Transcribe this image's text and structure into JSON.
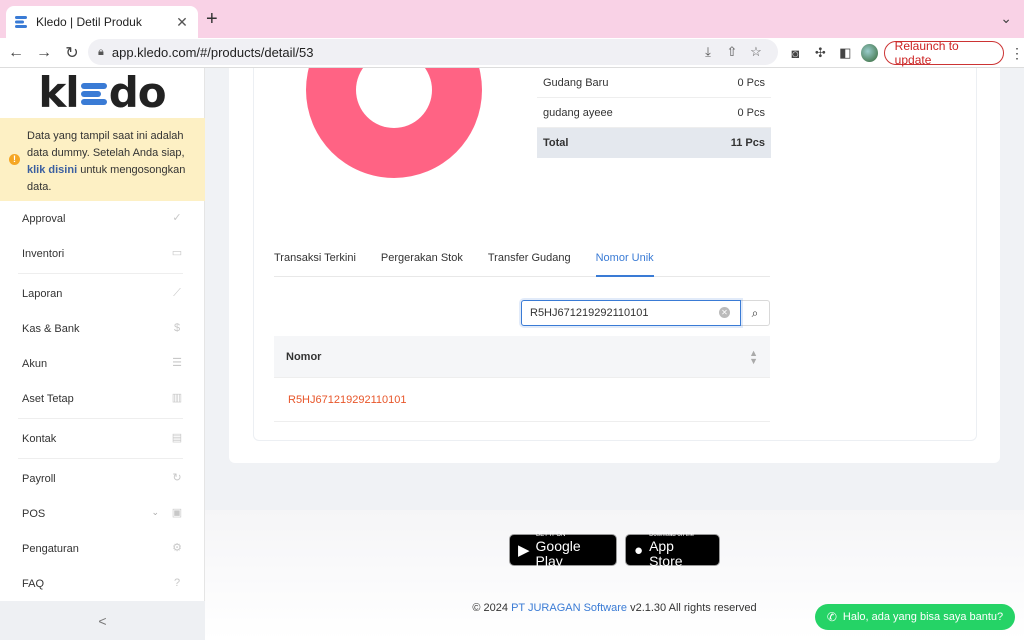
{
  "browser": {
    "tab_title": "Kledo | Detil Produk",
    "tab_close": "✕",
    "new_tab": "+",
    "url": "app.kledo.com/#/products/detail/53",
    "relaunch_label": "Relaunch to update"
  },
  "sidebar": {
    "logo": {
      "k": "kl",
      "d": "do"
    },
    "notice": {
      "text_before": "Data yang tampil saat ini adalah data dummy. Setelah Anda siap, ",
      "link": "klik disini",
      "text_after": " untuk mengosongkan data."
    },
    "items": [
      {
        "label": "Approval",
        "icon": "check-icon"
      },
      {
        "label": "Inventori",
        "icon": "briefcase-icon"
      },
      {
        "label": "Laporan",
        "icon": "chart-icon"
      },
      {
        "label": "Kas & Bank",
        "icon": "dollar-icon"
      },
      {
        "label": "Akun",
        "icon": "list-icon"
      },
      {
        "label": "Aset Tetap",
        "icon": "building-icon"
      },
      {
        "label": "Kontak",
        "icon": "contact-card-icon"
      },
      {
        "label": "Payroll",
        "icon": "refresh-icon"
      },
      {
        "label": "POS",
        "icon": "pos-icon"
      },
      {
        "label": "Pengaturan",
        "icon": "gears-icon"
      },
      {
        "label": "FAQ",
        "icon": "question-icon"
      }
    ],
    "collapse_label": "<"
  },
  "stock": {
    "rows": [
      {
        "name": "Gudang Baru",
        "qty": "0 Pcs"
      },
      {
        "name": "gudang ayeee",
        "qty": "0 Pcs"
      }
    ],
    "total": {
      "name": "Total",
      "qty": "11 Pcs"
    }
  },
  "tabs": [
    {
      "label": "Transaksi Terkini",
      "active": false
    },
    {
      "label": "Pergerakan Stok",
      "active": false
    },
    {
      "label": "Transfer Gudang",
      "active": false
    },
    {
      "label": "Nomor Unik",
      "active": true
    }
  ],
  "search": {
    "value": "R5HJ671219292110101"
  },
  "list": {
    "header": "Nomor",
    "rows": [
      "R5HJ671219292110101"
    ]
  },
  "footer": {
    "google_play": {
      "small": "GET IT ON",
      "big": "Google Play"
    },
    "app_store": {
      "small": "Download on the",
      "big": "App Store"
    },
    "copyright_prefix": "© 2024 ",
    "copyright_brand": "PT JURAGAN Software",
    "copyright_suffix": " v2.1.30 All rights reserved"
  },
  "whatsapp": {
    "label": "Halo, ada yang bisa saya bantu?"
  },
  "colors": {
    "accent": "#3a7bd5",
    "donut": "#ff6384",
    "link_orange": "#e8562a",
    "whatsapp": "#25d366"
  }
}
